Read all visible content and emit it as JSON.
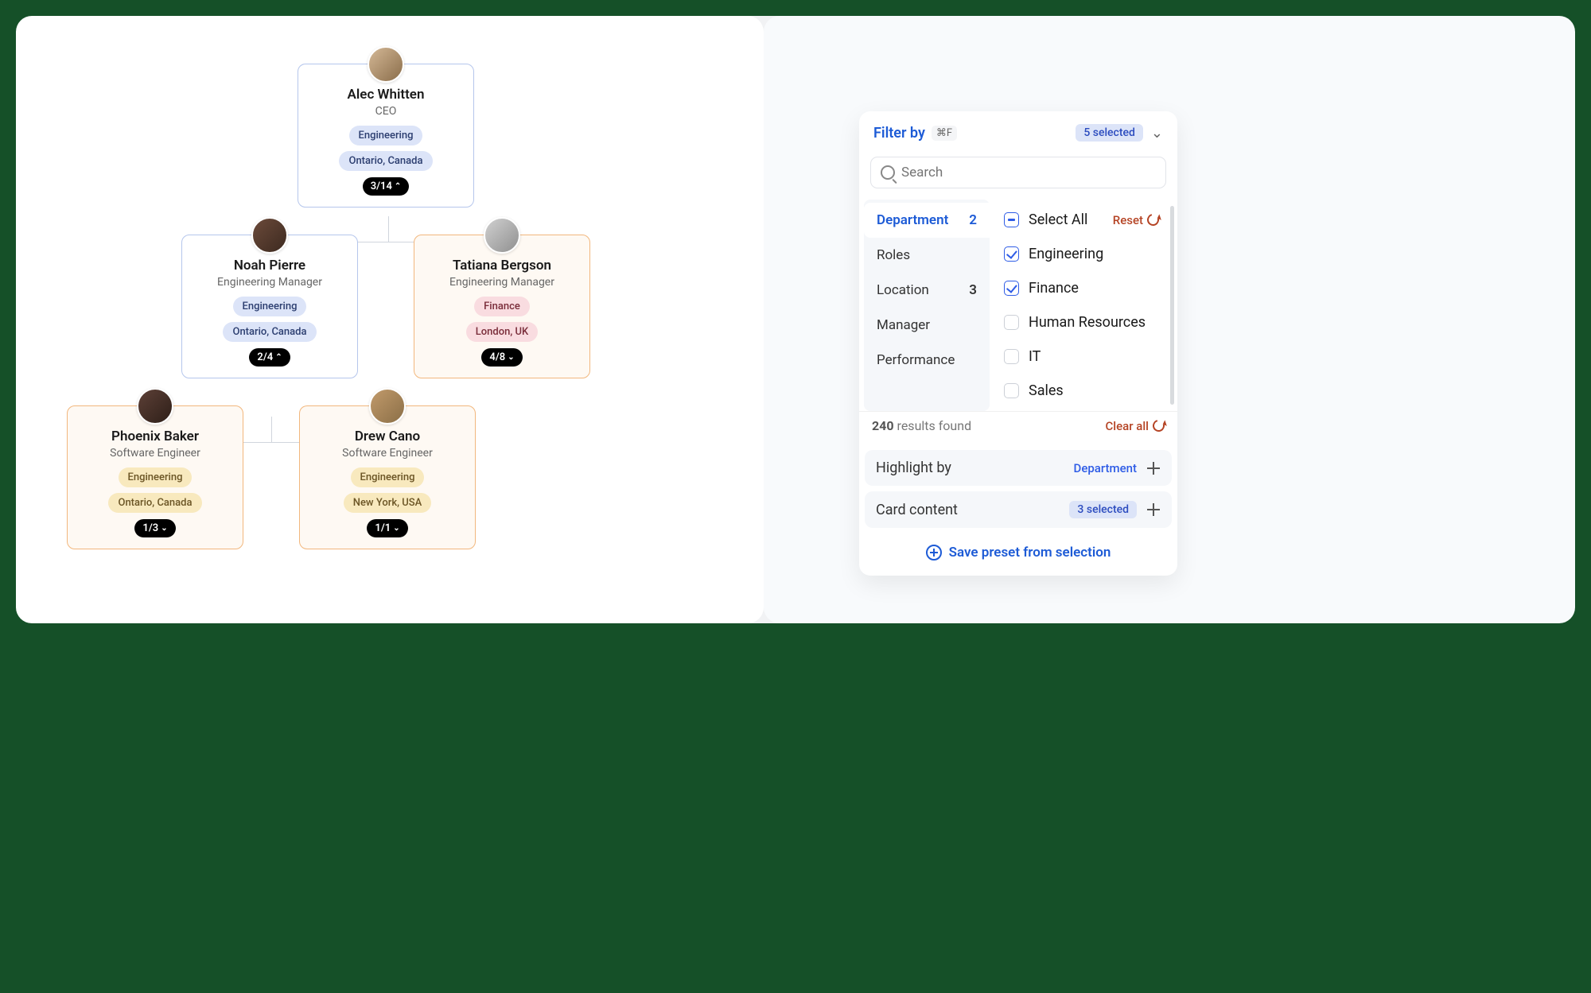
{
  "org": {
    "root": {
      "name": "Alec Whitten",
      "role": "CEO",
      "tags": [
        {
          "text": "Engineering",
          "variant": "blue"
        },
        {
          "text": "Ontario, Canada",
          "variant": "blue"
        }
      ],
      "count": "3/14",
      "expanded": true,
      "variant": "blue"
    },
    "level2": [
      {
        "name": "Noah Pierre",
        "role": "Engineering Manager",
        "tags": [
          {
            "text": "Engineering",
            "variant": "blue"
          },
          {
            "text": "Ontario, Canada",
            "variant": "blue"
          }
        ],
        "count": "2/4",
        "expanded": true,
        "variant": "blue"
      },
      {
        "name": "Tatiana Bergson",
        "role": "Engineering Manager",
        "tags": [
          {
            "text": "Finance",
            "variant": "pink"
          },
          {
            "text": "London, UK",
            "variant": "pink"
          }
        ],
        "count": "4/8",
        "expanded": false,
        "variant": "orange"
      }
    ],
    "level3": [
      {
        "name": "Phoenix Baker",
        "role": "Software Engineer",
        "tags": [
          {
            "text": "Engineering",
            "variant": "yellow"
          },
          {
            "text": "Ontario, Canada",
            "variant": "yellow"
          }
        ],
        "count": "1/3",
        "expanded": false,
        "variant": "orange"
      },
      {
        "name": "Drew Cano",
        "role": "Software Engineer",
        "tags": [
          {
            "text": "Engineering",
            "variant": "yellow"
          },
          {
            "text": "New York, USA",
            "variant": "yellow"
          }
        ],
        "count": "1/1",
        "expanded": false,
        "variant": "orange"
      }
    ]
  },
  "filter": {
    "title": "Filter by",
    "shortcut": "⌘F",
    "selected_badge": "5 selected",
    "search_placeholder": "Search",
    "categories": [
      {
        "label": "Department",
        "count": "2",
        "active": true
      },
      {
        "label": "Roles",
        "count": "",
        "active": false
      },
      {
        "label": "Location",
        "count": "3",
        "active": false
      },
      {
        "label": "Manager",
        "count": "",
        "active": false
      },
      {
        "label": "Performance",
        "count": "",
        "active": false
      }
    ],
    "select_all": "Select All",
    "reset": "Reset",
    "options": [
      {
        "label": "Engineering",
        "checked": true
      },
      {
        "label": "Finance",
        "checked": true
      },
      {
        "label": "Human Resources",
        "checked": false
      },
      {
        "label": "IT",
        "checked": false
      },
      {
        "label": "Sales",
        "checked": false
      }
    ],
    "results_count": "240",
    "results_label": "results found",
    "clear_all": "Clear all",
    "highlight_label": "Highlight by",
    "highlight_value": "Department",
    "card_content_label": "Card content",
    "card_content_badge": "3 selected",
    "save_preset": "Save preset from selection"
  }
}
